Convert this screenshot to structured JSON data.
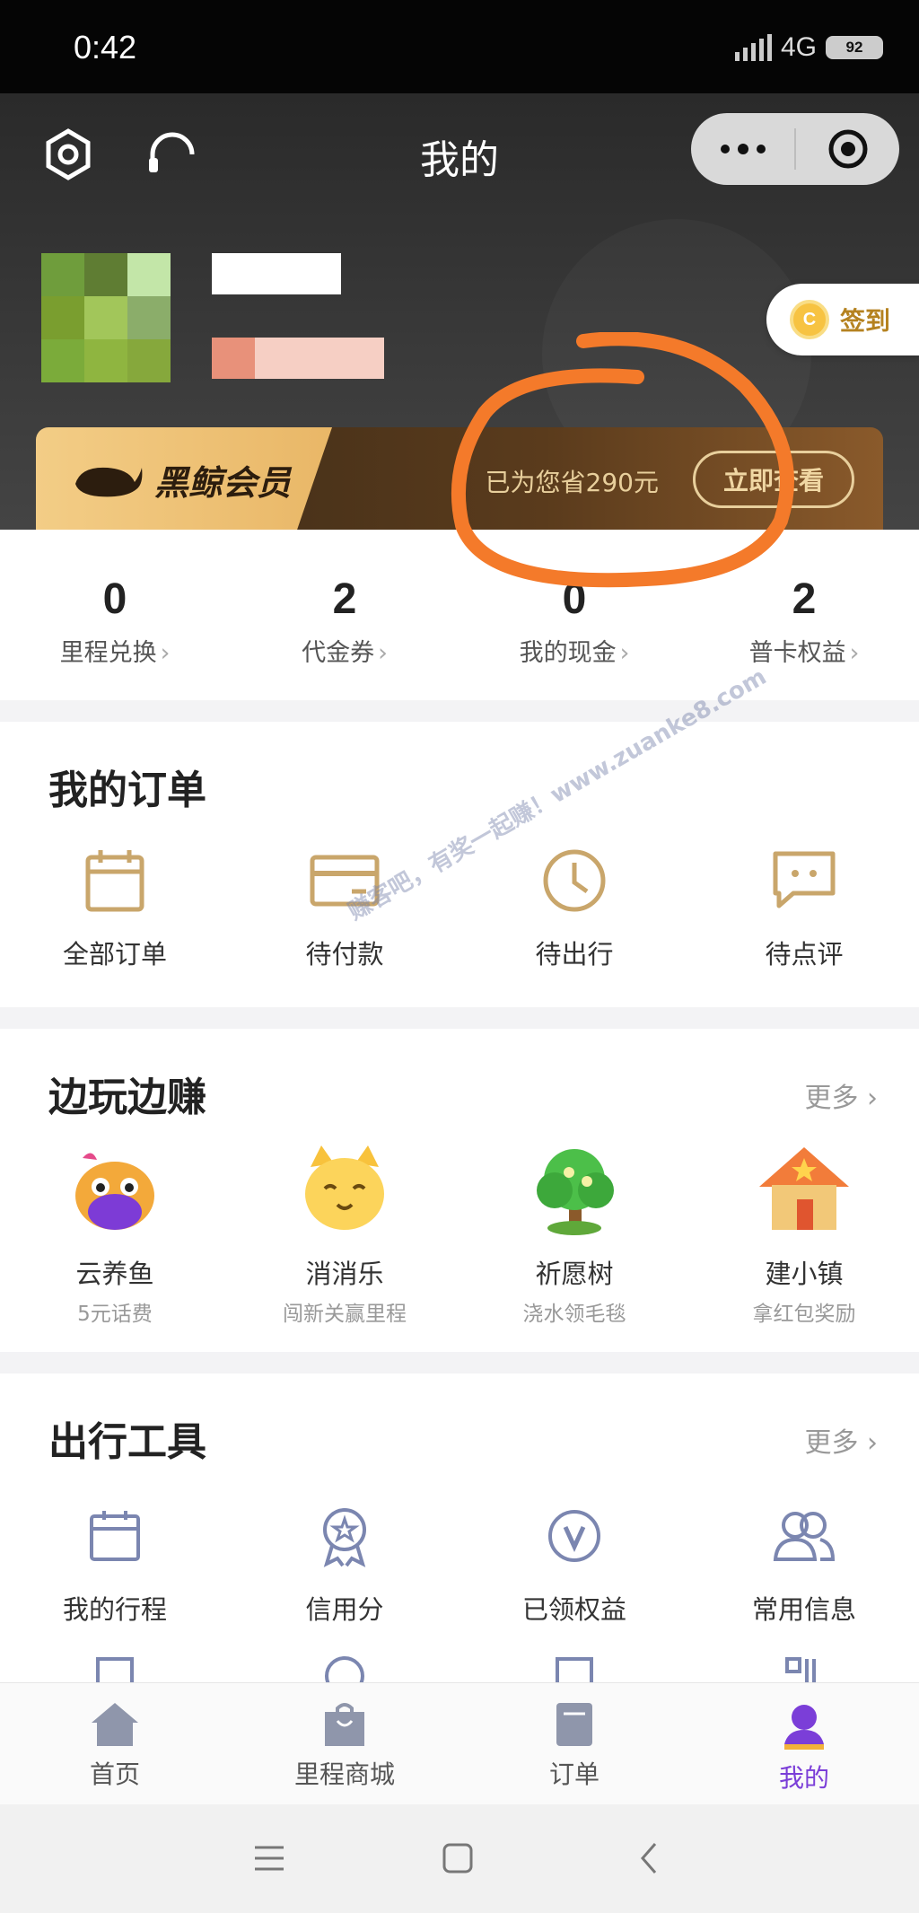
{
  "status_bar": {
    "time": "0:42",
    "network": "4G",
    "battery": "92"
  },
  "header": {
    "title": "我的"
  },
  "signin": {
    "label": "签到",
    "coin_letter": "C"
  },
  "vip": {
    "badge": "黑鲸会员",
    "saved_text": "已为您省290元",
    "button": "立即查看"
  },
  "stats": [
    {
      "value": "0",
      "label": "里程兑换"
    },
    {
      "value": "2",
      "label": "代金券"
    },
    {
      "value": "0",
      "label": "我的现金"
    },
    {
      "value": "2",
      "label": "普卡权益"
    }
  ],
  "orders": {
    "title": "我的订单",
    "items": [
      {
        "label": "全部订单",
        "icon": "calendar-icon"
      },
      {
        "label": "待付款",
        "icon": "card-icon"
      },
      {
        "label": "待出行",
        "icon": "clock-icon"
      },
      {
        "label": "待点评",
        "icon": "chat-icon"
      }
    ]
  },
  "games": {
    "title": "边玩边赚",
    "more": "更多",
    "items": [
      {
        "label": "云养鱼",
        "sub": "5元话费",
        "icon": "fish-icon"
      },
      {
        "label": "消消乐",
        "sub": "闯新关赢里程",
        "icon": "cat-icon"
      },
      {
        "label": "祈愿树",
        "sub": "浇水领毛毯",
        "icon": "tree-icon"
      },
      {
        "label": "建小镇",
        "sub": "拿红包奖励",
        "icon": "house-icon"
      }
    ]
  },
  "tools": {
    "title": "出行工具",
    "more": "更多",
    "items": [
      {
        "label": "我的行程",
        "icon": "itinerary-icon"
      },
      {
        "label": "信用分",
        "icon": "badge-icon"
      },
      {
        "label": "已领权益",
        "icon": "vip-v-icon"
      },
      {
        "label": "常用信息",
        "icon": "people-icon"
      }
    ]
  },
  "watermark": "赚客吧，有奖一起赚！www.zuanke8.com",
  "tabbar": [
    {
      "label": "首页",
      "icon": "home-icon"
    },
    {
      "label": "里程商城",
      "icon": "shopping-bag-icon"
    },
    {
      "label": "订单",
      "icon": "order-book-icon"
    },
    {
      "label": "我的",
      "icon": "user-icon",
      "active": true
    }
  ],
  "colors": {
    "accent_gold": "#c9a66b",
    "active_tab": "#7b3ed8",
    "annotation": "#f47a2a"
  }
}
